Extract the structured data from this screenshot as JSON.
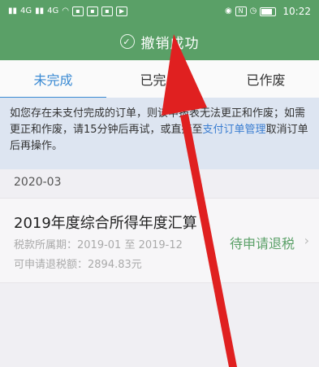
{
  "status_bar": {
    "left_indicators": [
      "4G",
      "4G"
    ],
    "time": "10:22"
  },
  "toast": {
    "message": "撤销成功"
  },
  "tabs": [
    {
      "label": "未完成",
      "active": true
    },
    {
      "label": "已完成",
      "active": false
    },
    {
      "label": "已作废",
      "active": false
    }
  ],
  "notice": {
    "text_before": "如您存在未支付完成的订单，则该申报表无法更正和作废；如需更正和作废，请15分钟后再试，或直接至",
    "link": "支付订单管理",
    "text_after": "取消订单后再操作。"
  },
  "section": {
    "date": "2020-03"
  },
  "record": {
    "title": "2019年度综合所得年度汇算",
    "period_label": "税款所属期：",
    "period_value": "2019-01 至 2019-12",
    "refund_label": "可申请退税额：",
    "refund_value": "2894.83元",
    "status": "待申请退税"
  },
  "colors": {
    "header_green": "#5aa067",
    "tab_active_blue": "#3a8ad3",
    "notice_bg": "#dde5f1",
    "annotation_red": "#e02020"
  }
}
